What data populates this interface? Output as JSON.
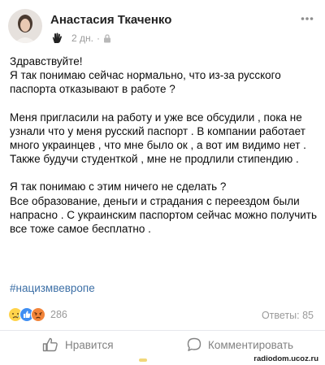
{
  "author": {
    "name": "Анастасия Ткаченко"
  },
  "meta": {
    "time": "2 дн.",
    "separator": "·"
  },
  "post": {
    "paragraphs": [
      "Здравствуйте!\nЯ так понимаю сейчас нормально, что из-за русского паспорта отказывают в работе ?",
      "Меня пригласили на работу и уже все обсудили , пока не узнали что у меня русский паспорт .  В компании работает много украинцев , что мне было ок , а вот им видимо нет . Также будучи студенткой , мне не продлили стипендию .",
      "Я так понимаю с этим ничего не сделать ?\nВсе образование, деньги и страдания с переездом были напрасно . С украинским паспортом сейчас можно получить все тоже самое бесплатно ."
    ],
    "hashtag": "#нацизмвевропе"
  },
  "reactions": {
    "count": "286",
    "icons": [
      "sad-icon",
      "like-icon",
      "angry-icon"
    ]
  },
  "comments": {
    "label": "Ответы: 85"
  },
  "actions": {
    "like_label": "Нравится",
    "comment_label": "Комментировать"
  },
  "watermark": "radiodom.ucoz.ru",
  "colors": {
    "hashtag": "#3c6fa6",
    "muted": "#9a9a9a",
    "action": "#828282",
    "text": "#0b0b0b"
  }
}
